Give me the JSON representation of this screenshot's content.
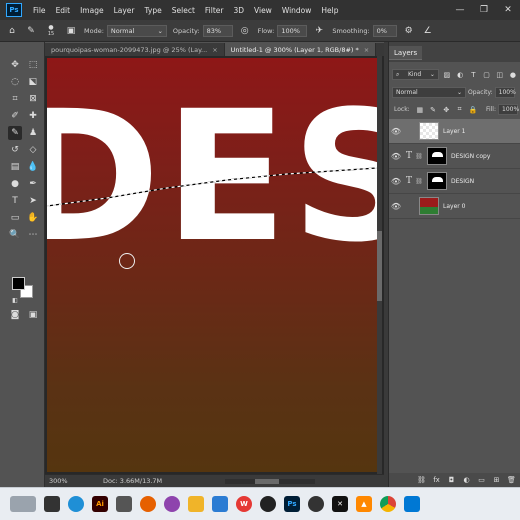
{
  "menu": [
    "File",
    "Edit",
    "Image",
    "Layer",
    "Type",
    "Select",
    "Filter",
    "3D",
    "View",
    "Window",
    "Help"
  ],
  "app_logo": "Ps",
  "window_controls": [
    "—",
    "❐",
    "✕"
  ],
  "options": {
    "brush_size": "15",
    "mode_label": "Mode:",
    "mode_value": "Normal",
    "opacity_label": "Opacity:",
    "opacity_value": "83%",
    "flow_label": "Flow:",
    "flow_value": "100%",
    "smoothing_label": "Smoothing:",
    "smoothing_value": "0%"
  },
  "tabs": [
    {
      "label": "pourquoipas-woman-2099473.jpg @ 25% (Lay...",
      "close": "×",
      "active": false
    },
    {
      "label": "Untitled-1 @ 300% (Layer 1, RGB/8#) *",
      "close": "×",
      "active": true
    }
  ],
  "canvas": {
    "big_text": "DES",
    "bg_top": "#8e1717",
    "bg_bottom": "#55350f"
  },
  "status": {
    "zoom": "300%",
    "doc_info": "Doc: 3.66M/13.7M"
  },
  "layers_panel": {
    "title": "Layers",
    "kind_label": "Kind",
    "blend_mode": "Normal",
    "opacity_label": "Opacity:",
    "opacity_value": "100%",
    "lock_label": "Lock:",
    "fill_label": "Fill:",
    "fill_value": "100%",
    "layers": [
      {
        "name": "Layer 1",
        "type": "pixel",
        "active": true
      },
      {
        "name": "DESIGN copy",
        "type": "text",
        "active": false
      },
      {
        "name": "DESIGN",
        "type": "text",
        "active": false
      },
      {
        "name": "Layer 0",
        "type": "photo",
        "active": false
      }
    ]
  },
  "colors": {
    "foreground": "#000000",
    "background": "#ffffff",
    "accent": "#31a8ff"
  }
}
